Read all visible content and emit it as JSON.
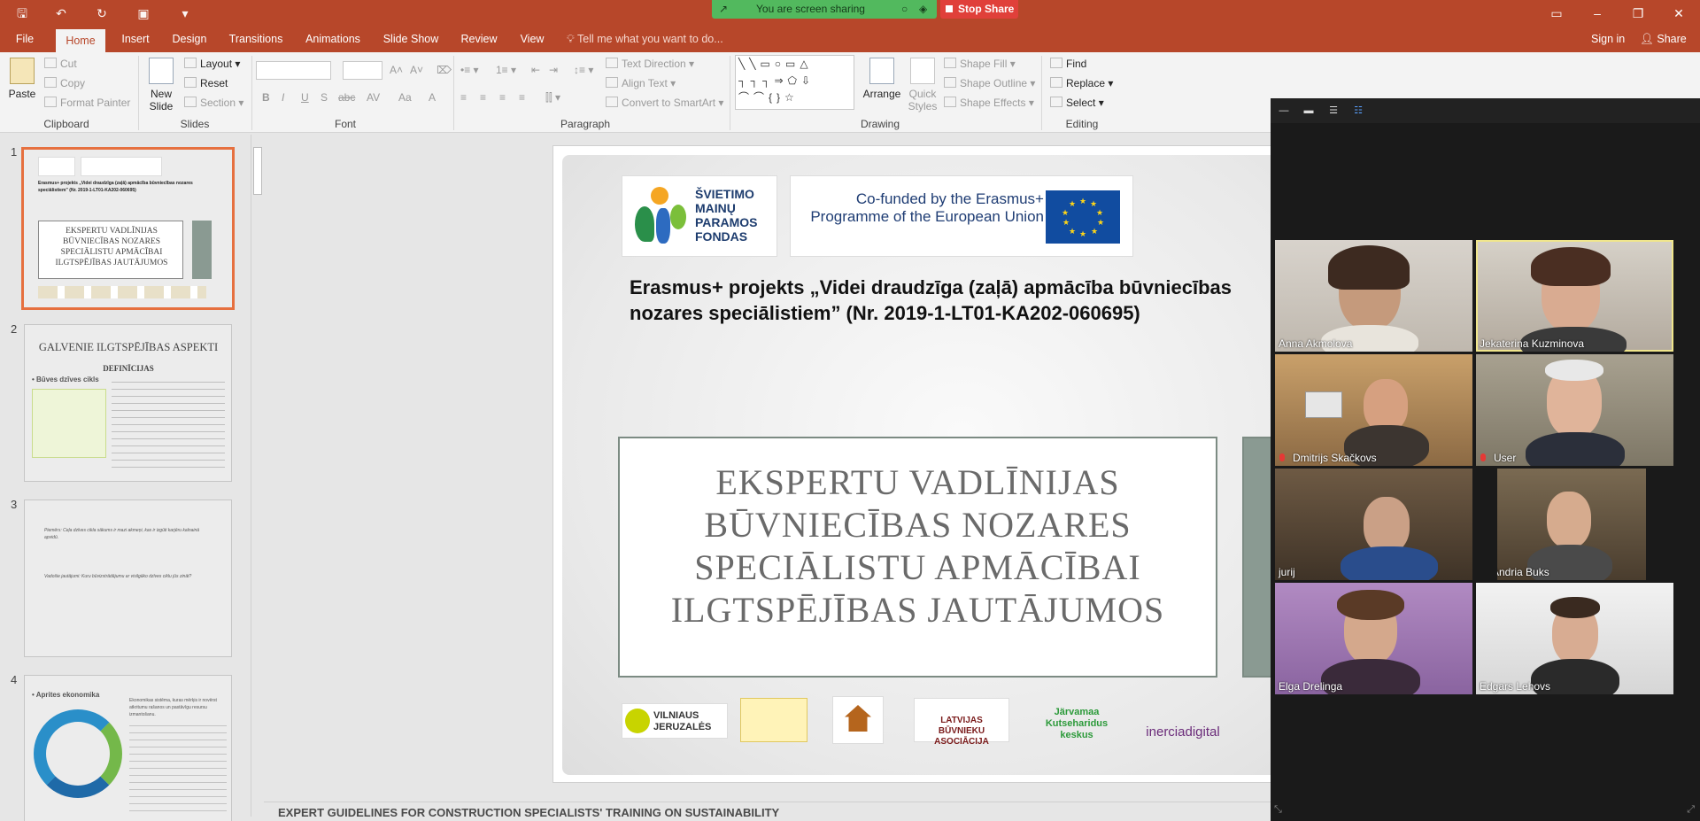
{
  "titlebar": {
    "screen_sharing": "You are screen sharing",
    "stop_share": "Stop Share"
  },
  "tabs": [
    "File",
    "Home",
    "Insert",
    "Design",
    "Transitions",
    "Animations",
    "Slide Show",
    "Review",
    "View"
  ],
  "tell_me": "Tell me what you want to do...",
  "signin": "Sign in",
  "share": "Share",
  "ribbon": {
    "clipboard": {
      "paste": "Paste",
      "cut": "Cut",
      "copy": "Copy",
      "format_painter": "Format Painter",
      "label": "Clipboard"
    },
    "slides": {
      "new_slide": "New Slide",
      "layout": "Layout",
      "reset": "Reset",
      "section": "Section",
      "label": "Slides"
    },
    "font": {
      "label": "Font",
      "bold": "B",
      "italic": "I",
      "underline": "U",
      "strike": "S",
      "shadow": "abc",
      "spacing": "AV",
      "case": "Aa",
      "color": "A"
    },
    "paragraph": {
      "text_direction": "Text Direction",
      "align_text": "Align Text",
      "convert_smartart": "Convert to SmartArt",
      "label": "Paragraph"
    },
    "drawing": {
      "arrange": "Arrange",
      "quick_styles": "Quick Styles",
      "shape_fill": "Shape Fill",
      "shape_outline": "Shape Outline",
      "shape_effects": "Shape Effects",
      "label": "Drawing"
    },
    "editing": {
      "find": "Find",
      "replace": "Replace",
      "select": "Select",
      "label": "Editing"
    }
  },
  "thumbnails": [
    {
      "num": "1",
      "title": "EKSPERTU VADLĪNIJAS BŪVNIECĪBAS NOZARES SPECIĀLISTU APMĀCĪBAI ILGTSPĒJĪBAS JAUTĀJUMOS",
      "subtitle": "Erasmus+ projekts „Videi draudzīga (zaļā) apmācība būvniecības nozares speciālistiem” (Nr. 2019-1-LT01-KA202-060695)"
    },
    {
      "num": "2",
      "title": "GALVENIE ILGTSPĒJĪBAS ASPEKTI",
      "subtitle": "DEFINĪCIJAS",
      "bullet": "• Būves dzīves cikls"
    },
    {
      "num": "3",
      "subtitle": "Piemērs: Ceļa dzīves cikla sākums ir mazi akmeņi, kas ir izgūti karjēru kalnainā apvidū.",
      "bullet": "Vadošie jautājumi: Kuru būvizstrādājumu ar visilgāko dzīves ciklu jūs zināt?"
    },
    {
      "num": "4",
      "bullet": "• Aprites ekonomika",
      "subtitle": "Ekonomikas sistēma, kuras mērķis ir novērst atkritumu rašanos un pastāvīgu resursu izmantošanu."
    }
  ],
  "slide": {
    "logo1": "ŠVIETIMO MAINŲ PARAMOS FONDAS",
    "eu_text": "Co-funded by the Erasmus+ Programme of the European Union",
    "project_title": "Erasmus+ projekts „Videi draudzīga (zaļā) apmācība būvniecības nozares speciālistiem” (Nr. 2019-1-LT01-KA202-060695)",
    "main_title": "EKSPERTU VADLĪNIJAS BŪVNIECĪBAS NOZARES SPECIĀLISTU APMĀCĪBAI ILGTSPĒJĪBAS JAUTĀJUMOS",
    "partner_logos": [
      "VILNIAUS JERUZALĖS",
      "",
      "",
      "LATVIJAS BŪVNIEKU ASOCIĀCIJA",
      "Järvamaa Kutseharidus keskus",
      "inerciadigital"
    ]
  },
  "notes": "EXPERT GUIDELINES FOR CONSTRUCTION SPECIALISTS' TRAINING ON SUSTAINABILITY",
  "participants": [
    {
      "name": "Anna Akmolova",
      "active": false,
      "muted": false
    },
    {
      "name": "Jekaterina Kuzminova",
      "active": true,
      "muted": false
    },
    {
      "name": "Dmitrijs Skačkovs",
      "active": false,
      "muted": true
    },
    {
      "name": "User",
      "active": false,
      "muted": true
    },
    {
      "name": "jurij",
      "active": false,
      "muted": false
    },
    {
      "name": "Andria Buks",
      "active": false,
      "muted": false
    },
    {
      "name": "Elga Drelinga",
      "active": false,
      "muted": false
    },
    {
      "name": "Edgars Lehovs",
      "active": false,
      "muted": false
    }
  ]
}
